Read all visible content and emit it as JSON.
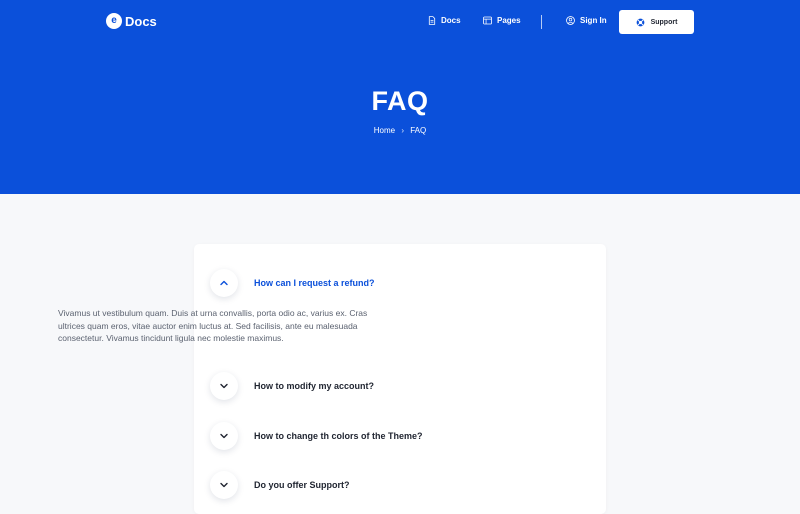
{
  "brand": {
    "mark": "e",
    "name": "Docs"
  },
  "nav": {
    "docs": "Docs",
    "pages": "Pages",
    "signin": "Sign In",
    "support": "Support"
  },
  "hero": {
    "title": "FAQ",
    "breadcrumb": {
      "home": "Home",
      "separator": "›",
      "current": "FAQ"
    }
  },
  "faqs": [
    {
      "question": "How can I request a refund?",
      "answer": "Vivamus ut vestibulum quam. Duis at urna convallis, porta odio ac, varius ex. Cras ultrices quam eros, vitae auctor enim luctus at. Sed facilisis, ante eu malesuada consectetur. Vivamus tincidunt ligula nec molestie maximus.",
      "expanded": true
    },
    {
      "question": "How to modify my account?",
      "expanded": false
    },
    {
      "question": "How to change th colors of the Theme?",
      "expanded": false
    },
    {
      "question": "Do you offer Support?",
      "expanded": false
    }
  ],
  "colors": {
    "primary": "#0b50da",
    "background": "#f7f8fa",
    "card": "#ffffff",
    "text": "#1f2430",
    "muted": "#5b6270"
  },
  "icons": {
    "docs": "document-icon",
    "pages": "layout-icon",
    "signin": "user-icon",
    "support": "lifebuoy-icon",
    "expanded": "chevron-up-icon",
    "collapsed": "chevron-down-icon"
  }
}
